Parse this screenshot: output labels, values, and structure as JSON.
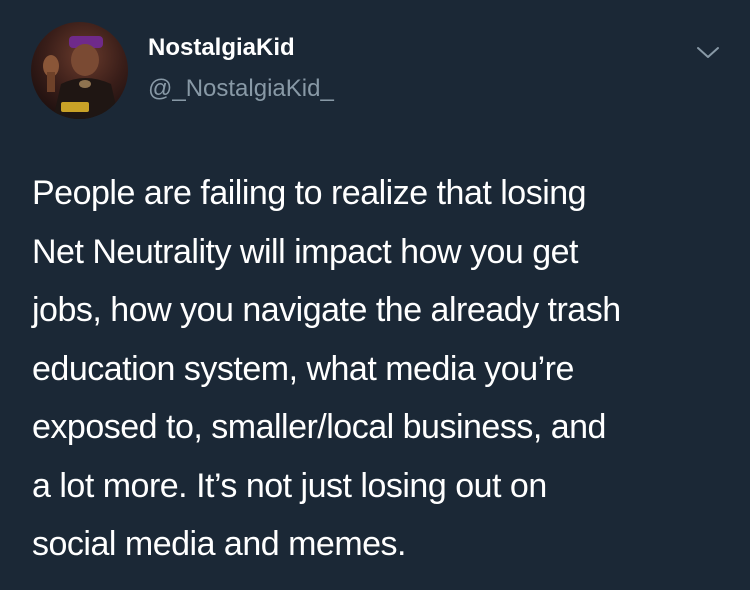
{
  "author": {
    "display_name": "NostalgiaKid",
    "handle": "@_NostalgiaKid_",
    "avatar_icon": "profile-photo"
  },
  "menu": {
    "icon": "chevron-down-icon"
  },
  "tweet": {
    "lines": [
      "People are failing to realize that losing",
      "Net Neutrality will impact how you get",
      "jobs, how you navigate the already trash",
      "education system, what media you’re",
      "exposed to, smaller/local business, and",
      "a lot more. It’s not just losing out on",
      "social media and memes."
    ]
  },
  "colors": {
    "background": "#1b2836",
    "text": "#ffffff",
    "secondary_text": "#8899a6"
  }
}
